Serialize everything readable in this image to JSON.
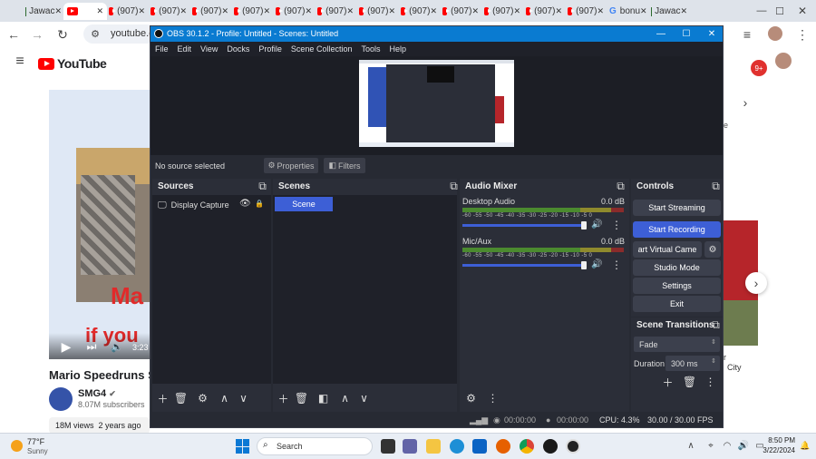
{
  "browser": {
    "tabs": [
      {
        "label": "Jawac",
        "type": "img"
      },
      {
        "label": "",
        "type": "yt",
        "active": true
      },
      {
        "label": "(907)",
        "type": "yt"
      },
      {
        "label": "(907)",
        "type": "yt"
      },
      {
        "label": "(907)",
        "type": "yt"
      },
      {
        "label": "(907)",
        "type": "yt"
      },
      {
        "label": "(907)",
        "type": "yt"
      },
      {
        "label": "(907)",
        "type": "yt"
      },
      {
        "label": "(907)",
        "type": "yt"
      },
      {
        "label": "(907)",
        "type": "yt"
      },
      {
        "label": "(907)",
        "type": "yt"
      },
      {
        "label": "(907)",
        "type": "yt"
      },
      {
        "label": "(907)",
        "type": "yt"
      },
      {
        "label": "(907)",
        "type": "yt"
      },
      {
        "label": "bonu",
        "type": "g"
      },
      {
        "label": "Jawac",
        "type": "img"
      }
    ],
    "url": "youtube.co",
    "notif_count": "9+"
  },
  "youtube": {
    "logo": "YouTube",
    "video_title": "Mario Speedruns Sup",
    "channel": "SMG4",
    "subscribers": "8.07M subscribers",
    "views": "18M views",
    "age": "2 years ago",
    "time": "3:23",
    "overlay_text": "if you",
    "side_text1": "r",
    "side_text2": "City",
    "side_brand": "Ma"
  },
  "obs": {
    "title": "OBS 30.1.2 - Profile: Untitled - Scenes: Untitled",
    "menu": [
      "File",
      "Edit",
      "View",
      "Docks",
      "Profile",
      "Scene Collection",
      "Tools",
      "Help"
    ],
    "no_source": "No source selected",
    "properties": "Properties",
    "filters": "Filters",
    "sources_title": "Sources",
    "source_item": "Display Capture",
    "scenes_title": "Scenes",
    "scene_item": "Scene",
    "mixer_title": "Audio Mixer",
    "desktop_audio": "Desktop Audio",
    "desktop_db": "0.0 dB",
    "mic_aux": "Mic/Aux",
    "mic_db": "0.0 dB",
    "scale": "-60  -55  -50  -45  -40  -35  -30  -25  -20  -15  -10   -5    0",
    "controls_title": "Controls",
    "start_streaming": "Start Streaming",
    "start_recording": "Start Recording",
    "virtual_cam": "art Virtual Came",
    "studio_mode": "Studio Mode",
    "settings": "Settings",
    "exit": "Exit",
    "transitions_title": "Scene Transitions",
    "transition": "Fade",
    "duration_label": "Duration",
    "duration_value": "300 ms",
    "status_rec1": "00:00:00",
    "status_rec2": "00:00:00",
    "cpu": "CPU: 4.3%",
    "fps": "30.00 / 30.00 FPS"
  },
  "taskbar": {
    "temp": "77°F",
    "weather": "Sunny",
    "search": "Search",
    "time": "8:50 PM",
    "date": "3/22/2024"
  },
  "colors": {
    "obs_title": "#0a7bd1",
    "obs_accent": "#3d5fd6",
    "yt_red": "#ff0000"
  }
}
